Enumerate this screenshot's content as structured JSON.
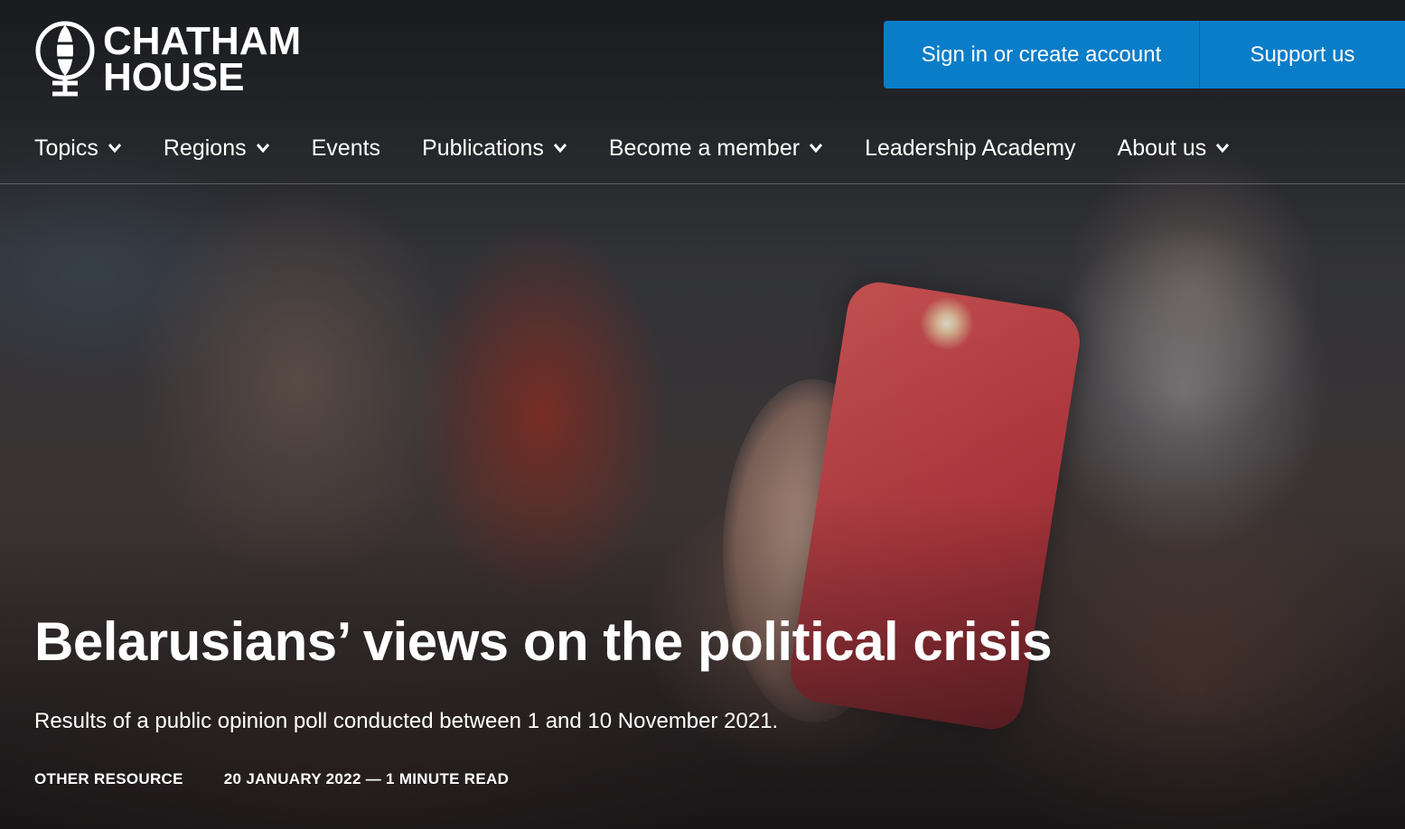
{
  "brand": {
    "line1": "CHATHAM",
    "line2": "HOUSE"
  },
  "header": {
    "signin_label": "Sign in or create account",
    "support_label": "Support us",
    "accent_color": "#0a7dc8"
  },
  "nav": {
    "items": [
      {
        "label": "Topics",
        "has_dropdown": true
      },
      {
        "label": "Regions",
        "has_dropdown": true
      },
      {
        "label": "Events",
        "has_dropdown": false
      },
      {
        "label": "Publications",
        "has_dropdown": true
      },
      {
        "label": "Become a member",
        "has_dropdown": true
      },
      {
        "label": "Leadership Academy",
        "has_dropdown": false
      },
      {
        "label": "About us",
        "has_dropdown": true
      }
    ]
  },
  "article": {
    "title": "Belarusians’ views on the political crisis",
    "subtitle": "Results of a public opinion poll conducted between 1 and 10 November 2021.",
    "type": "OTHER RESOURCE",
    "date_read": "20 JANUARY 2022 — 1 MINUTE READ"
  }
}
